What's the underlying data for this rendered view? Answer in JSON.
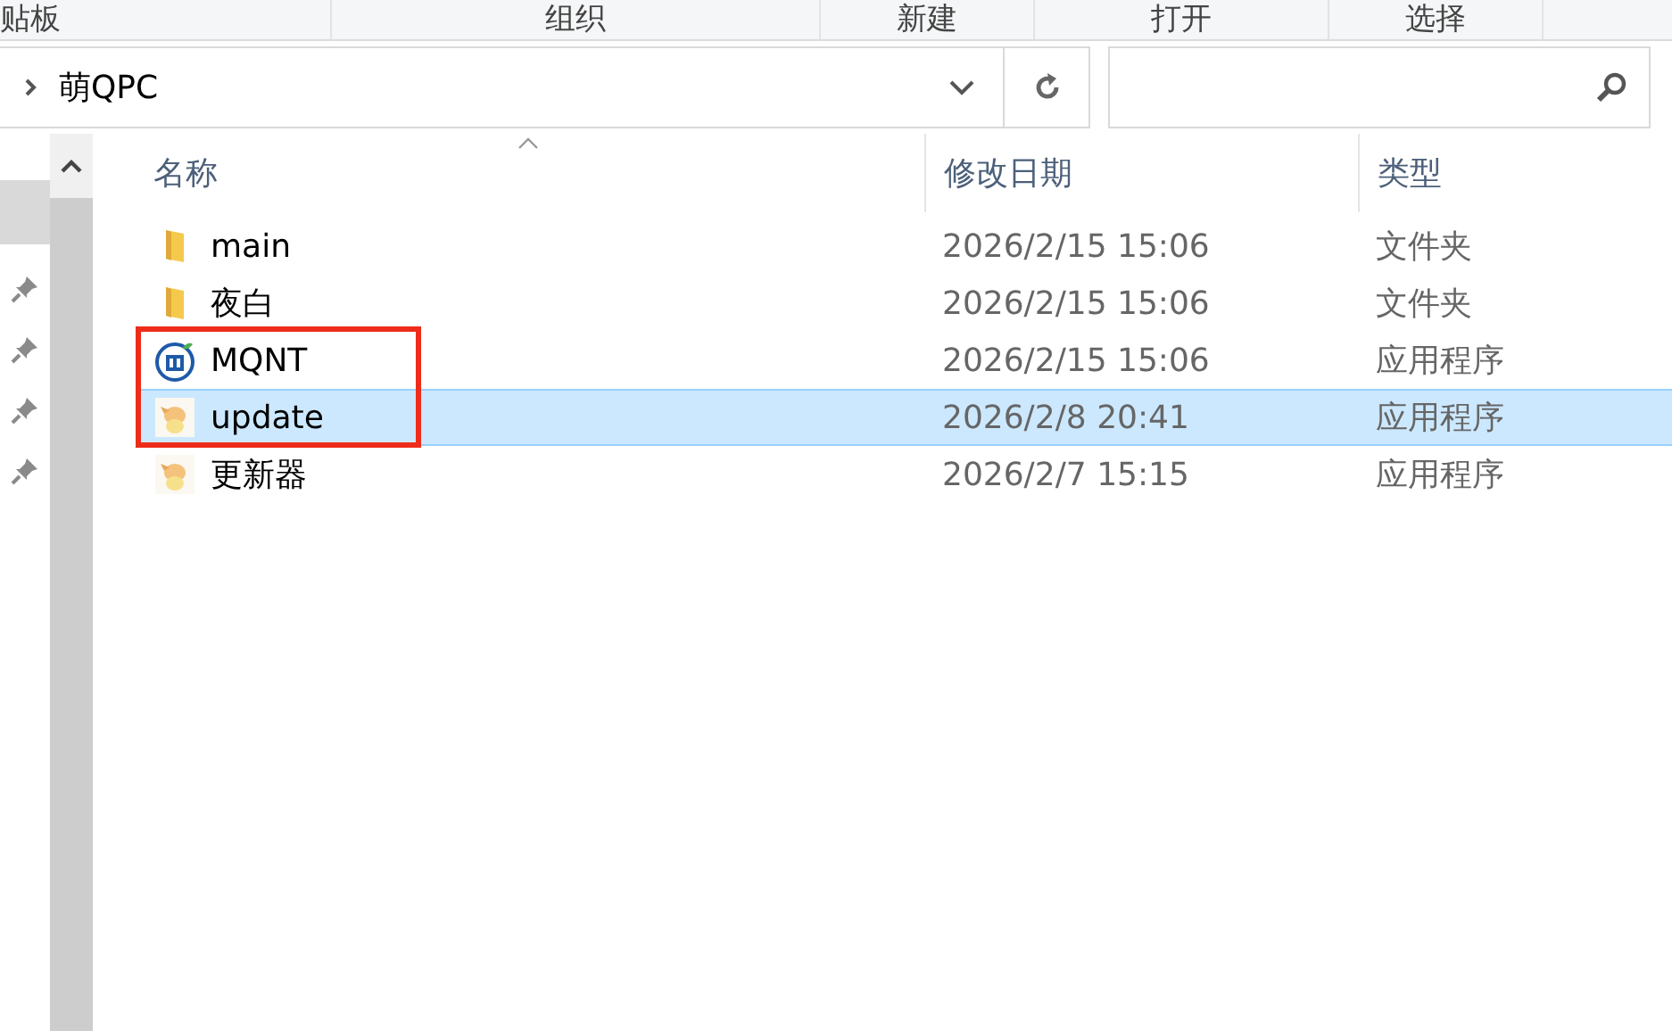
{
  "ribbon_groups": [
    "贴板",
    "组织",
    "新建",
    "打开",
    "选择"
  ],
  "address": {
    "path": "萌QPC"
  },
  "columns": [
    "名称",
    "修改日期",
    "类型"
  ],
  "rows": [
    {
      "kind": "folder",
      "name": "main",
      "date": "2026/2/15 15:06",
      "type": "文件夹",
      "selected": false,
      "outlined": false
    },
    {
      "kind": "folder",
      "name": "夜白",
      "date": "2026/2/15 15:06",
      "type": "文件夹",
      "selected": false,
      "outlined": false
    },
    {
      "kind": "app-badge",
      "name": "MQNT",
      "date": "2026/2/15 15:06",
      "type": "应用程序",
      "selected": false,
      "outlined": true
    },
    {
      "kind": "app-figure",
      "name": "update",
      "date": "2026/2/8 20:41",
      "type": "应用程序",
      "selected": true,
      "outlined": true
    },
    {
      "kind": "app-figure",
      "name": "更新器",
      "date": "2026/2/7 15:15",
      "type": "应用程序",
      "selected": false,
      "outlined": false
    }
  ]
}
